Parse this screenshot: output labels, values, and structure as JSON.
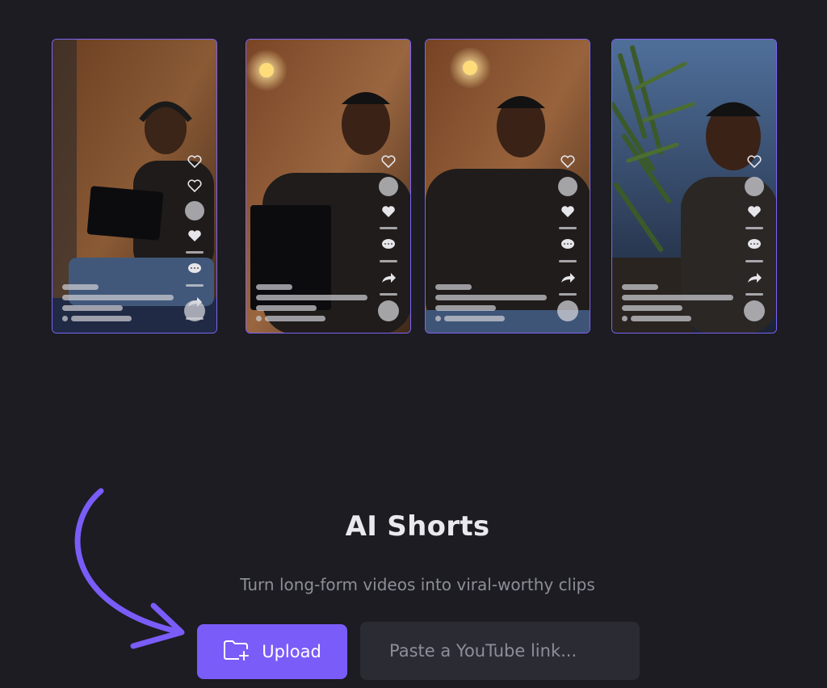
{
  "hero": {
    "title": "AI Shorts",
    "subtitle": "Turn long-form videos into viral-worthy clips"
  },
  "actions": {
    "upload_label": "Upload",
    "link_placeholder": "Paste a YouTube link..."
  },
  "preview_cards": [
    {
      "scene": "man-with-headphones-tablet"
    },
    {
      "scene": "man-with-laptop-smiling"
    },
    {
      "scene": "man-sitting-smiling"
    },
    {
      "scene": "man-speaking-near-plant"
    }
  ],
  "colors": {
    "background": "#1c1c22",
    "accent": "#7a5cf8",
    "card_border": "#7d63f5",
    "input_bg": "#2b2b33"
  },
  "icons": {
    "upload": "folder-plus-icon",
    "overlay": [
      "heart-icon",
      "heart-icon",
      "comment-icon",
      "share-icon"
    ],
    "arrow": "curved-arrow-icon"
  }
}
